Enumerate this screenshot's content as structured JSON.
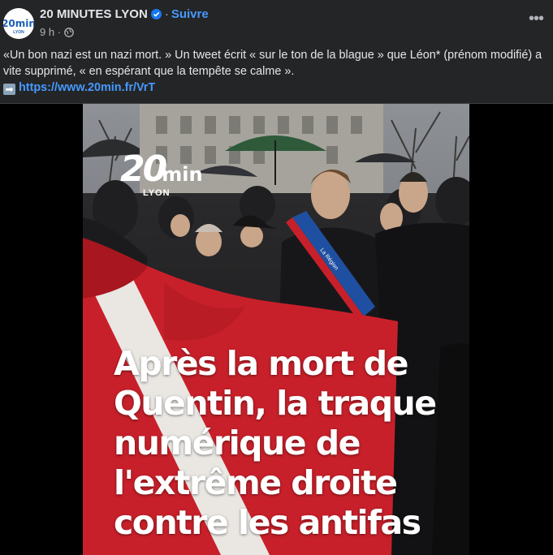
{
  "post": {
    "page_name": "20 MINUTES LYON",
    "follow_label": "Suivre",
    "time": "9 h",
    "more_label": "•••",
    "avatar_text": "20min",
    "avatar_city": "LYON",
    "text_line": "«Un bon nazi est un nazi mort. » Un tweet écrit « sur le ton de la blague » que Léon* (prénom modifié) a vite supprimé, « en espérant que la tempête se calme ».",
    "link_emoji": "➡",
    "link": "https://www.20min.fr/VrT"
  },
  "image": {
    "logo_number": "20",
    "logo_suffix": "min",
    "logo_city": "LYON",
    "sash_text": "La Région",
    "headline_lines": [
      "Après la mort de",
      "Quentin, la traque",
      "numérique de",
      "l'extrême droite",
      "contre les antifas"
    ]
  },
  "colors": {
    "background": "#242526",
    "link": "#4599ff",
    "verified": "#1877f2",
    "flag_red": "#c8202a",
    "sash_blue": "#1f4fa0"
  },
  "icons": [
    "verified-badge-icon",
    "globe-icon",
    "more-options-icon",
    "right-arrow-emoji-icon"
  ]
}
